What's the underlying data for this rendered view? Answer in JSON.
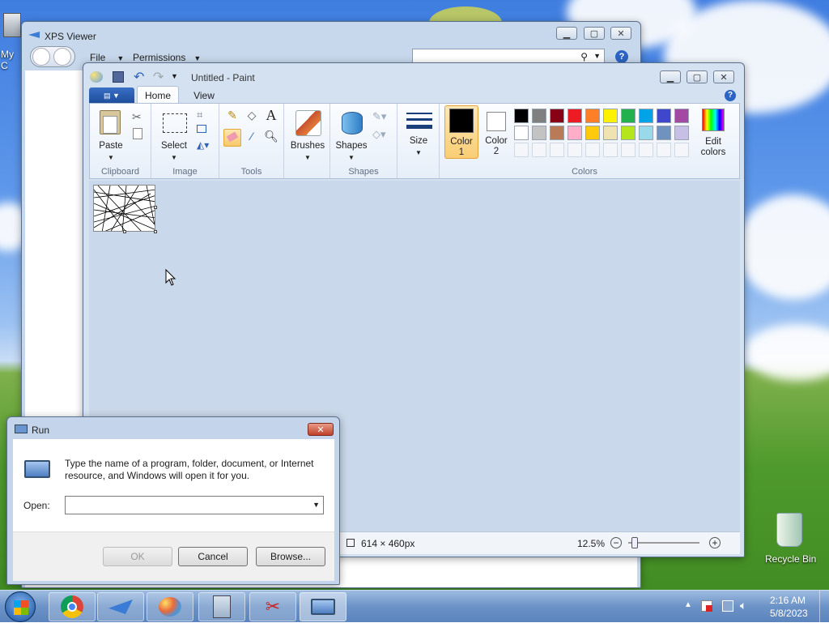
{
  "desktop": {
    "recycle_bin_label": "Recycle Bin",
    "partial_icon_label": "My C"
  },
  "xps": {
    "title": "XPS Viewer",
    "menu": {
      "file": "File",
      "permissions": "Permissions"
    }
  },
  "paint": {
    "title": "Untitled - Paint",
    "tabs": {
      "home": "Home",
      "view": "View"
    },
    "groups": {
      "clipboard": "Clipboard",
      "image": "Image",
      "tools": "Tools",
      "shapes": "Shapes",
      "colors": "Colors"
    },
    "buttons": {
      "paste": "Paste",
      "select": "Select",
      "brushes": "Brushes",
      "shapes": "Shapes",
      "size": "Size",
      "color1_a": "Color",
      "color1_b": "1",
      "color2_a": "Color",
      "color2_b": "2",
      "edit_a": "Edit",
      "edit_b": "colors"
    },
    "colors": {
      "color1": "#000000",
      "color2": "#ffffff",
      "accent": "#fbd78b"
    },
    "palette_row1": [
      "#000000",
      "#7f7f7f",
      "#880015",
      "#ed1c24",
      "#ff7f27",
      "#fff200",
      "#22b14c",
      "#00a2e8",
      "#3f48cc",
      "#a349a4"
    ],
    "palette_row2": [
      "#ffffff",
      "#c3c3c3",
      "#b97a57",
      "#ffaec9",
      "#ffc90e",
      "#efe4b0",
      "#b5e61d",
      "#99d9ea",
      "#7092be",
      "#c8bfe7"
    ],
    "status": {
      "dimensions": "614 × 460px",
      "zoom": "12.5%"
    }
  },
  "run": {
    "title": "Run",
    "description": "Type the name of a program, folder, document, or Internet resource, and Windows will open it for you.",
    "open_label": "Open:",
    "open_value": "",
    "ok": "OK",
    "cancel": "Cancel",
    "browse": "Browse..."
  },
  "clock": {
    "time": "2:16 AM",
    "date": "5/8/2023"
  }
}
